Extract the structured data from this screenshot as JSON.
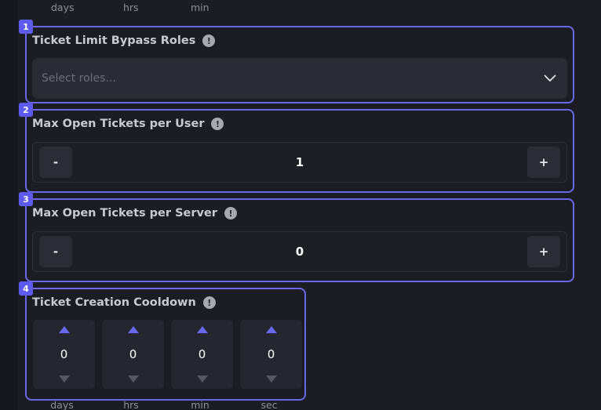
{
  "top_units": [
    "days",
    "hrs",
    "min"
  ],
  "sections": [
    {
      "badge": "1",
      "title": "Ticket Limit Bypass Roles",
      "info": "!",
      "placeholder": "Select roles..."
    },
    {
      "badge": "2",
      "title": "Max Open Tickets per User",
      "info": "!",
      "decrement": "-",
      "value": "1",
      "increment": "+"
    },
    {
      "badge": "3",
      "title": "Max Open Tickets per Server",
      "info": "!",
      "decrement": "-",
      "value": "0",
      "increment": "+"
    },
    {
      "badge": "4",
      "title": "Ticket Creation Cooldown",
      "info": "!",
      "cooldown": [
        {
          "value": "0",
          "unit": "days"
        },
        {
          "value": "0",
          "unit": "hrs"
        },
        {
          "value": "0",
          "unit": "min"
        },
        {
          "value": "0",
          "unit": "sec"
        }
      ]
    }
  ],
  "colors": {
    "background": "#1c1d23",
    "accent": "#6a68e8",
    "badge": "#5d5bef",
    "input_bg": "#2a2c33",
    "button_bg": "#2b2d35"
  },
  "icons": [
    "info-icon",
    "chevron-down-icon",
    "arrow-up-icon",
    "arrow-down-icon"
  ]
}
